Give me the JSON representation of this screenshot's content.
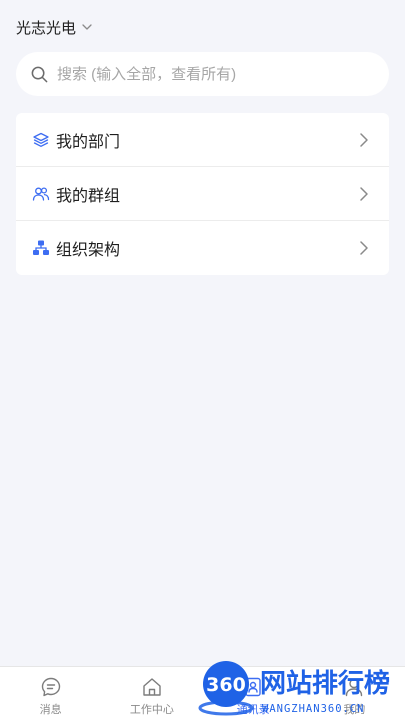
{
  "header": {
    "org_name": "光志光电",
    "chevron_icon": "chevron-down-icon"
  },
  "search": {
    "placeholder": "搜索 (输入全部，查看所有)",
    "icon": "search-icon"
  },
  "menu": {
    "items": [
      {
        "label": "我的部门",
        "icon": "layers-icon"
      },
      {
        "label": "我的群组",
        "icon": "group-icon"
      },
      {
        "label": "组织架构",
        "icon": "org-chart-icon"
      }
    ]
  },
  "nav": {
    "tabs": [
      {
        "label": "消息",
        "icon": "message-icon",
        "active": false
      },
      {
        "label": "工作中心",
        "icon": "home-icon",
        "active": false
      },
      {
        "label": "通讯录",
        "icon": "contacts-icon",
        "active": true
      },
      {
        "label": "我的",
        "icon": "profile-icon",
        "active": false
      }
    ]
  },
  "watermark": {
    "logo_number": "360",
    "title": "网站排行榜",
    "url": "WANGZHAN360.CN"
  },
  "colors": {
    "accent": "#3d6df2",
    "background": "#f4f5fa",
    "card": "#ffffff",
    "watermark_blue": "#1f62e6"
  }
}
